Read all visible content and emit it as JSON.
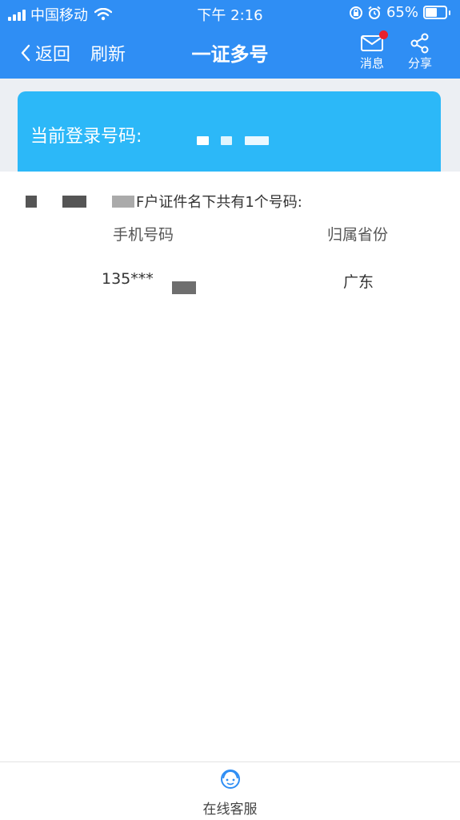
{
  "status_bar": {
    "carrier": "中国移动",
    "time": "下午 2:16",
    "battery_percent": "65%",
    "battery_level": 0.65
  },
  "navbar": {
    "back_label": "返回",
    "refresh_label": "刷新",
    "title": "一证多号",
    "messages_label": "消息",
    "share_label": "分享"
  },
  "login_card": {
    "label": "当前登录号码:"
  },
  "content": {
    "subtitle": "F户证件名下共有1个号码:",
    "columns": [
      "手机号码",
      "归属省份"
    ],
    "rows": [
      {
        "phone": "135***",
        "province": "广东"
      }
    ]
  },
  "bottom": {
    "customer_service_label": "在线客服"
  },
  "colors": {
    "header_blue": "#2f8ef4",
    "card_blue": "#2cb8f8",
    "badge_red": "#e8212e"
  }
}
